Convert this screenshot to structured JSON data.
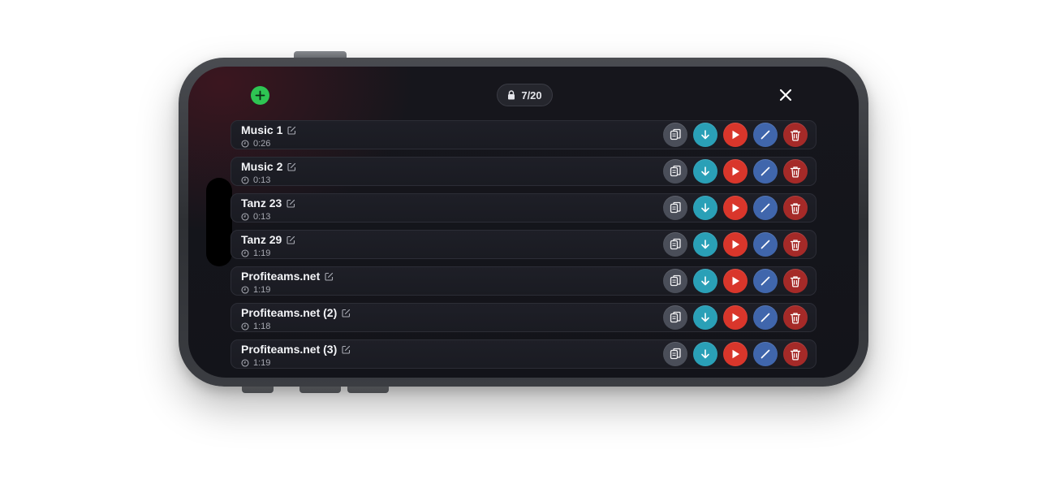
{
  "header": {
    "counter_text": "7/20",
    "add_icon": "plus-icon",
    "lock_icon": "lock-icon",
    "close_icon": "close-icon"
  },
  "colors": {
    "add": "#2ec553",
    "copy": "#4a4e59",
    "download": "#2aa0b7",
    "play": "#d9362b",
    "edit": "#4066ac",
    "delete": "#a52a28"
  },
  "row_actions": [
    "copy-icon",
    "download-icon",
    "play-icon",
    "pencil-icon",
    "trash-icon"
  ],
  "items": [
    {
      "title": "Music 1",
      "duration": "0:26"
    },
    {
      "title": "Music 2",
      "duration": "0:13"
    },
    {
      "title": "Tanz 23",
      "duration": "0:13"
    },
    {
      "title": "Tanz 29",
      "duration": "1:19"
    },
    {
      "title": "Profiteams.net",
      "duration": "1:19"
    },
    {
      "title": "Profiteams.net (2)",
      "duration": "1:18"
    },
    {
      "title": "Profiteams.net (3)",
      "duration": "1:19"
    }
  ]
}
